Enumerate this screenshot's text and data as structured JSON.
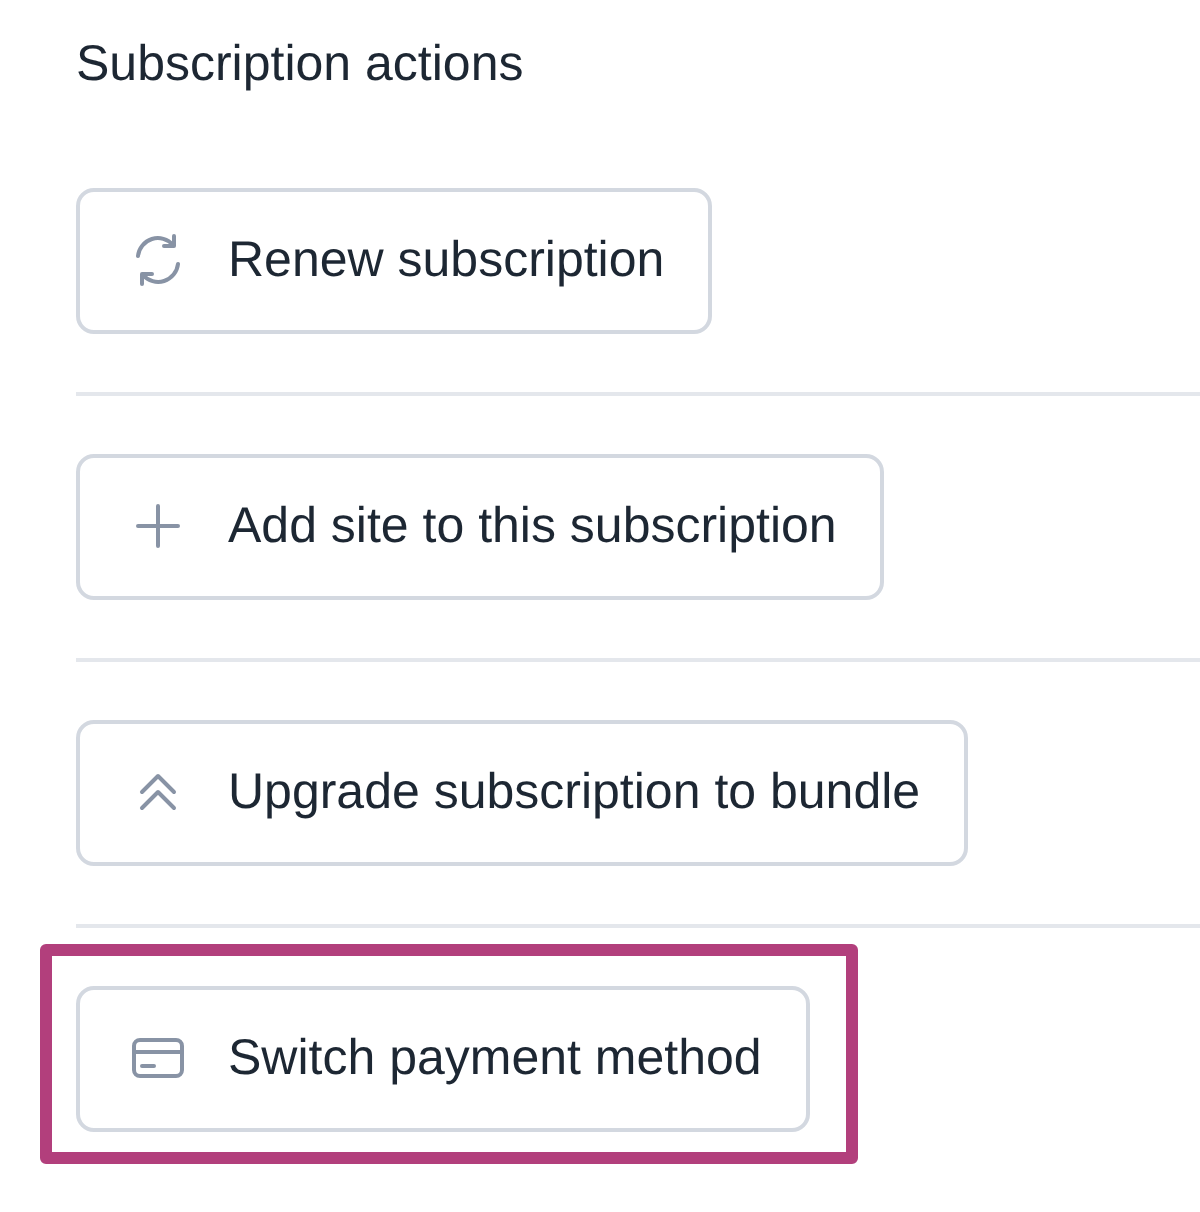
{
  "title": "Subscription actions",
  "actions": [
    {
      "kind": "renew",
      "label": "Renew subscription",
      "highlighted": false
    },
    {
      "kind": "add",
      "label": "Add site to this subscription",
      "highlighted": false
    },
    {
      "kind": "upgrade",
      "label": "Upgrade subscription to bundle",
      "highlighted": false
    },
    {
      "kind": "payment",
      "label": "Switch payment method",
      "highlighted": true
    }
  ]
}
